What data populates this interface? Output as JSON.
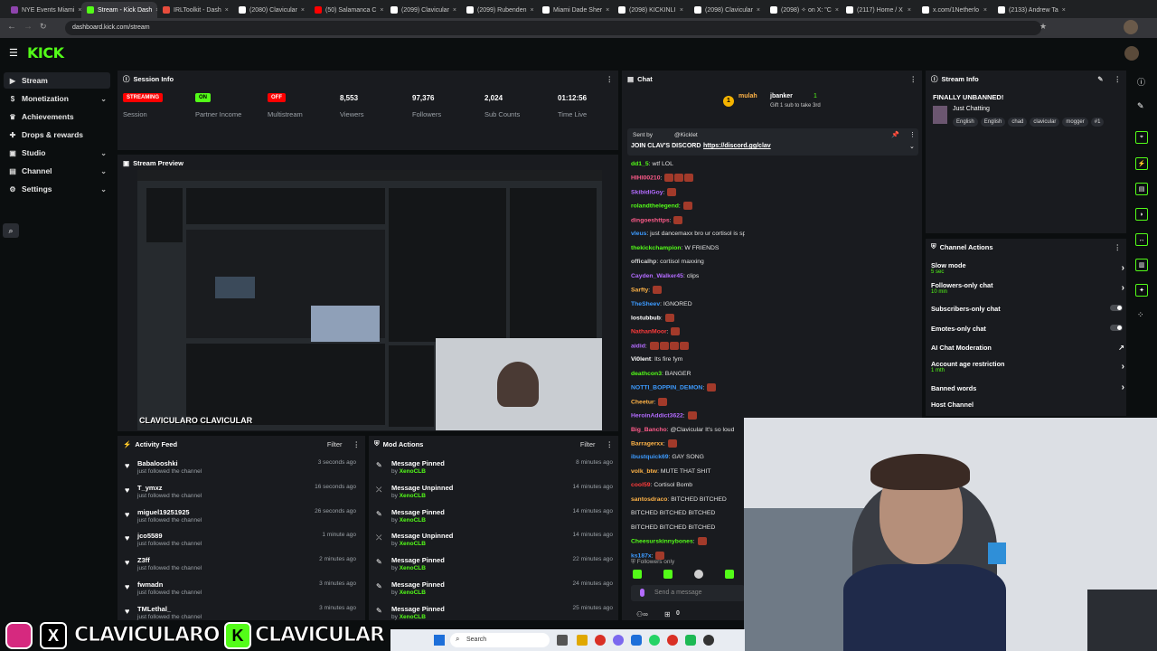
{
  "browser": {
    "tabs": [
      {
        "label": "NYE Events Miami",
        "color": "#8e44ad"
      },
      {
        "label": "Stream - Kick Dash",
        "color": "#53fc18",
        "active": true
      },
      {
        "label": "IRLToolkit - Dash",
        "color": "#e74c3c"
      },
      {
        "label": "(2080) Clavicular",
        "color": "#ffffff"
      },
      {
        "label": "(50) Salamanca C",
        "color": "#ff0000"
      },
      {
        "label": "(2099) Clavicular",
        "color": "#ffffff"
      },
      {
        "label": "(2099) Rubenden",
        "color": "#ffffff"
      },
      {
        "label": "Miami Dade Sher",
        "color": "#ffffff"
      },
      {
        "label": "(2098) KICKINLI",
        "color": "#ffffff"
      },
      {
        "label": "(2098) Clavicular",
        "color": "#ffffff"
      },
      {
        "label": "(2098) ✧ on X: \"C",
        "color": "#ffffff"
      },
      {
        "label": "(2117) Home / X",
        "color": "#ffffff"
      },
      {
        "label": "x.com/1Netherlo",
        "color": "#ffffff"
      },
      {
        "label": "(2133) Andrew Ta",
        "color": "#ffffff"
      }
    ],
    "url": "dashboard.kick.com/stream"
  },
  "brand": {
    "logo": "KICK",
    "accent": "#53fc18"
  },
  "sidebar": {
    "items": [
      {
        "label": "Stream",
        "icon": "stream-icon"
      },
      {
        "label": "Monetization",
        "icon": "dollar-icon",
        "chevron": true
      },
      {
        "label": "Achievements",
        "icon": "trophy-icon"
      },
      {
        "label": "Drops & rewards",
        "icon": "gift-icon"
      },
      {
        "label": "Studio",
        "icon": "video-icon",
        "chevron": true
      },
      {
        "label": "Channel",
        "icon": "channel-icon",
        "chevron": true
      },
      {
        "label": "Settings",
        "icon": "gear-icon",
        "chevron": true
      }
    ]
  },
  "session_info": {
    "title": "Session Info",
    "stats": [
      {
        "badge": "STREAMING",
        "label": "Session"
      },
      {
        "badge": "ON",
        "label": "Partner Income"
      },
      {
        "badge": "OFF",
        "label": "Multistream"
      },
      {
        "value": "8,553",
        "label": "Viewers"
      },
      {
        "value": "97,376",
        "label": "Followers"
      },
      {
        "value": "2,024",
        "label": "Sub Counts"
      },
      {
        "value": "01:12:56",
        "label": "Time Live"
      }
    ]
  },
  "stream_preview": {
    "title": "Stream Preview"
  },
  "activity_feed": {
    "title": "Activity Feed",
    "filter": "Filter",
    "items": [
      {
        "name": "Babalooshki",
        "action": "just followed the channel",
        "time": "3 seconds ago"
      },
      {
        "name": "T_ymxz",
        "action": "just followed the channel",
        "time": "16 seconds ago"
      },
      {
        "name": "miguel19251925",
        "action": "just followed the channel",
        "time": "26 seconds ago"
      },
      {
        "name": "jco5589",
        "action": "just followed the channel",
        "time": "1 minute ago"
      },
      {
        "name": "Z3ff",
        "action": "just followed the channel",
        "time": "2 minutes ago"
      },
      {
        "name": "fwmadn",
        "action": "just followed the channel",
        "time": "3 minutes ago"
      },
      {
        "name": "TMLethal_",
        "action": "just followed the channel",
        "time": "3 minutes ago"
      }
    ]
  },
  "mod_actions": {
    "title": "Mod Actions",
    "filter": "Filter",
    "items": [
      {
        "action": "Message Pinned",
        "by": "by",
        "mod": "XenoCLB",
        "time": "8 minutes ago"
      },
      {
        "action": "Message Unpinned",
        "by": "by",
        "mod": "XenoCLB",
        "time": "14 minutes ago"
      },
      {
        "action": "Message Pinned",
        "by": "by",
        "mod": "XenoCLB",
        "time": "14 minutes ago"
      },
      {
        "action": "Message Unpinned",
        "by": "by",
        "mod": "XenoCLB",
        "time": "14 minutes ago"
      },
      {
        "action": "Message Pinned",
        "by": "by",
        "mod": "XenoCLB",
        "time": "22 minutes ago"
      },
      {
        "action": "Message Pinned",
        "by": "by",
        "mod": "XenoCLB",
        "time": "24 minutes ago"
      },
      {
        "action": "Message Pinned",
        "by": "by",
        "mod": "XenoCLB",
        "time": "25 minutes ago"
      }
    ]
  },
  "chat": {
    "title": "Chat",
    "gift": {
      "user1": "mulah",
      "user2": "jbanker",
      "count": "1",
      "text": "Gift 1 sub to take 3rd"
    },
    "pinned": {
      "sent_by": "Sent by",
      "author": "@Kicklet",
      "text": "JOIN CLAV'S DISCORD",
      "link": "https://discord.gg/clav"
    },
    "messages": [
      {
        "user": "dd1_5",
        "text": "wtf LOL",
        "color": "#53fc18",
        "emotes": 0
      },
      {
        "user": "HIHI00210",
        "text": "",
        "color": "#ff5b8a",
        "emotes": 3
      },
      {
        "user": "SkibidiGoy",
        "text": "",
        "color": "#b36bff",
        "emotes": 1
      },
      {
        "user": "rolandthelegend",
        "text": "",
        "color": "#53fc18",
        "emotes": 1
      },
      {
        "user": "dingoeshttps",
        "text": "",
        "color": "#ff5b8a",
        "emotes": 1
      },
      {
        "user": "vleus",
        "text": "just dancemaxx bro ur cortisol is spiked",
        "color": "#3d9bff",
        "emotes": 0
      },
      {
        "user": "thekickchampion",
        "text": "W FRIENDS",
        "color": "#53fc18",
        "emotes": 0
      },
      {
        "user": "officalhp",
        "text": "cortisol maxxing",
        "color": "#d0d0d0",
        "emotes": 0
      },
      {
        "user": "Cayden_Walker45",
        "text": "clips",
        "color": "#b36bff",
        "emotes": 0
      },
      {
        "user": "Sarfty",
        "text": "",
        "color": "#ffb347",
        "emotes": 1
      },
      {
        "user": "TheSheev",
        "text": "IGNORED",
        "color": "#3d9bff",
        "emotes": 0
      },
      {
        "user": "lostubbub",
        "text": "",
        "color": "#ffffff",
        "emotes": 1
      },
      {
        "user": "NathanMoor",
        "text": "",
        "color": "#ff3b3b",
        "emotes": 1
      },
      {
        "user": "aidid",
        "text": "",
        "color": "#b36bff",
        "emotes": 4
      },
      {
        "user": "Vi0lent",
        "text": "Its fire fym",
        "color": "#ffffff",
        "emotes": 0
      },
      {
        "user": "deathcon3",
        "text": "BANGER",
        "color": "#53fc18",
        "emotes": 0
      },
      {
        "user": "NOTTI_BOPPIN_DEMON",
        "text": "",
        "color": "#3d9bff",
        "emotes": 1
      },
      {
        "user": "Cheetur",
        "text": "",
        "color": "#ffb347",
        "emotes": 1
      },
      {
        "user": "HeroinAddict3622",
        "text": "",
        "color": "#b36bff",
        "emotes": 1
      },
      {
        "user": "Big_Bancho",
        "text": "@Clavicular It's so loud",
        "color": "#ff5b8a",
        "emotes": 0
      },
      {
        "user": "Barragerxx",
        "text": "",
        "color": "#ffb347",
        "emotes": 1
      },
      {
        "user": "ibustquick69",
        "text": "GAY SONG",
        "color": "#3d9bff",
        "emotes": 0
      },
      {
        "user": "volk_btw",
        "text": "MUTE THAT SHIT",
        "color": "#ffb347",
        "emotes": 0
      },
      {
        "user": "cool59",
        "text": "Cortisol Bomb",
        "color": "#ff3b3b",
        "emotes": 0
      },
      {
        "user": "santosdraco",
        "text": "BITCHED BITCHED",
        "color": "#ffb347",
        "emotes": 0
      },
      {
        "user": "",
        "text": "BITCHED BITCHED BITCHED",
        "color": "#e0e0e0",
        "emotes": 0
      },
      {
        "user": "",
        "text": "BITCHED BITCHED BITCHED",
        "color": "#e0e0e0",
        "emotes": 0
      },
      {
        "user": "Cheesurskinnybones",
        "text": "",
        "color": "#53fc18",
        "emotes": 1
      },
      {
        "user": "ks187x",
        "text": "",
        "color": "#3d9bff",
        "emotes": 1
      }
    ],
    "followers_only": "Followers only",
    "send_placeholder": "Send a message",
    "count": "0"
  },
  "stream_info": {
    "title": "Stream Info",
    "stream_title": "FINALLY UNBANNED!",
    "category": "Just Chatting",
    "tags": [
      "English",
      "English",
      "chad",
      "clavicular",
      "mogger",
      "#1"
    ]
  },
  "channel_actions": {
    "title": "Channel Actions",
    "items": [
      {
        "label": "Slow mode",
        "sub": "5 sec",
        "control": "chevron"
      },
      {
        "label": "Followers-only chat",
        "sub": "10 min",
        "control": "chevron"
      },
      {
        "label": "Subscribers-only chat",
        "sub": "",
        "control": "toggle"
      },
      {
        "label": "Emotes-only chat",
        "sub": "",
        "control": "toggle"
      },
      {
        "label": "AI Chat Moderation",
        "sub": "",
        "control": "external"
      },
      {
        "label": "Account age restriction",
        "sub": "1 mth",
        "control": "chevron"
      },
      {
        "label": "Banned words",
        "sub": "",
        "control": "chevron"
      },
      {
        "label": "Host Channel",
        "sub": "",
        "control": "none"
      }
    ]
  },
  "overlay": {
    "handle1": "CLAVICULARO",
    "handle2": "CLAVICULAR"
  },
  "taskbar": {
    "search": "Search"
  }
}
